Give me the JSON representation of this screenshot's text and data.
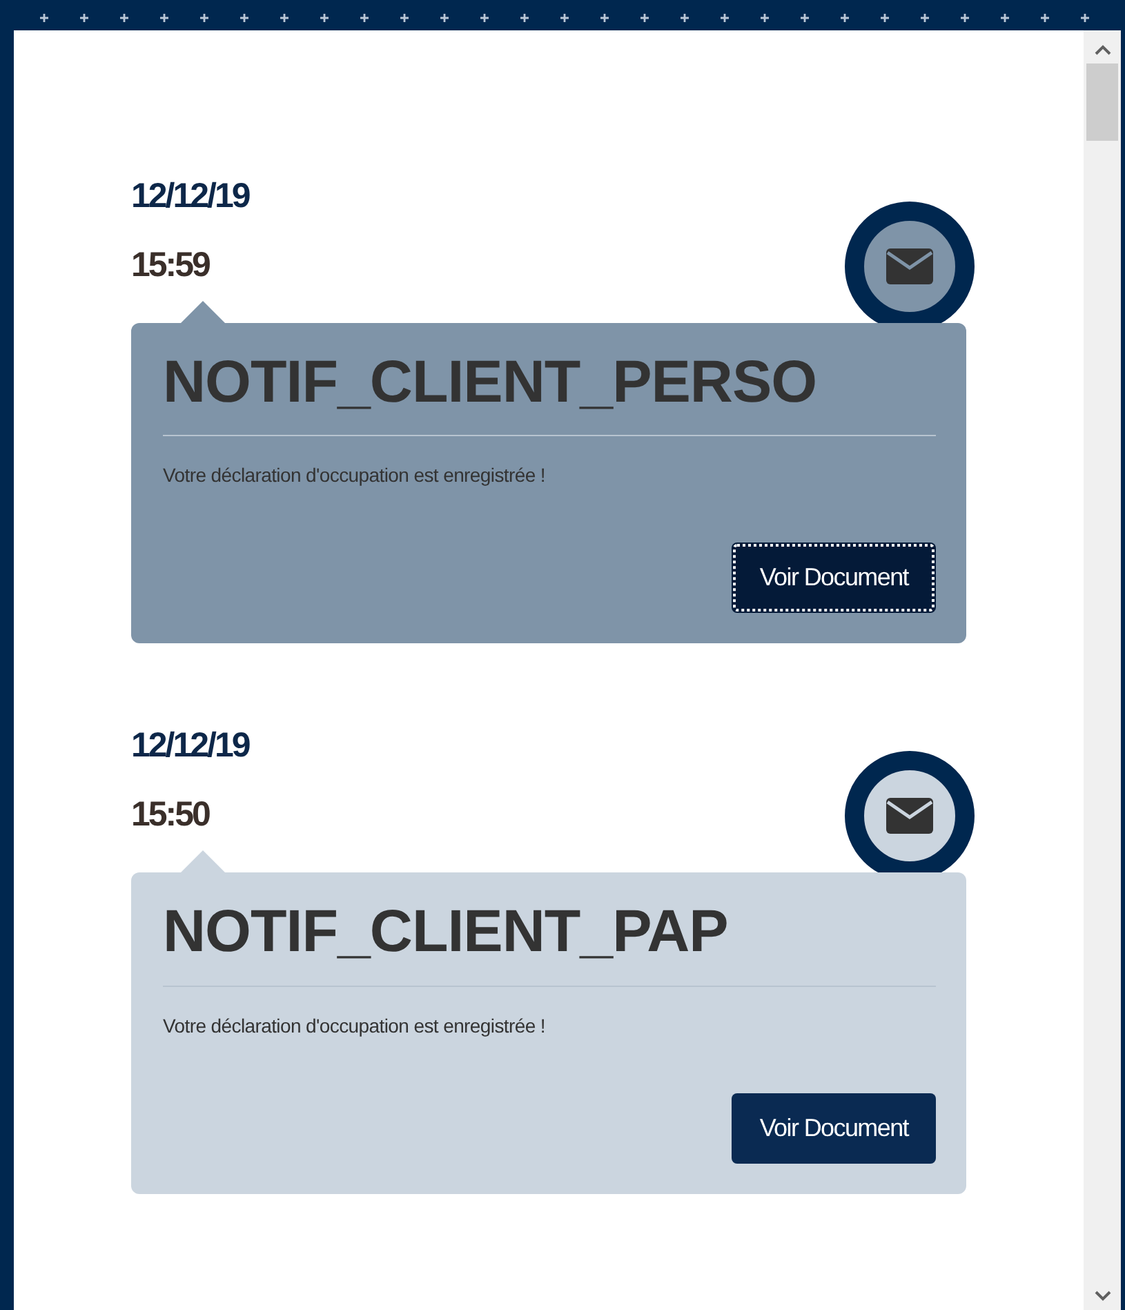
{
  "notifications": [
    {
      "date": "12/12/19",
      "time": "15:59",
      "title": "NOTIF_CLIENT_PERSO",
      "message": "Votre déclaration d'occupation est enregistrée !",
      "button": "Voir Document",
      "selected": true
    },
    {
      "date": "12/12/19",
      "time": "15:50",
      "title": "NOTIF_CLIENT_PAP",
      "message": "Votre déclaration d'occupation est enregistrée !",
      "button": "Voir Document",
      "selected": false
    }
  ]
}
